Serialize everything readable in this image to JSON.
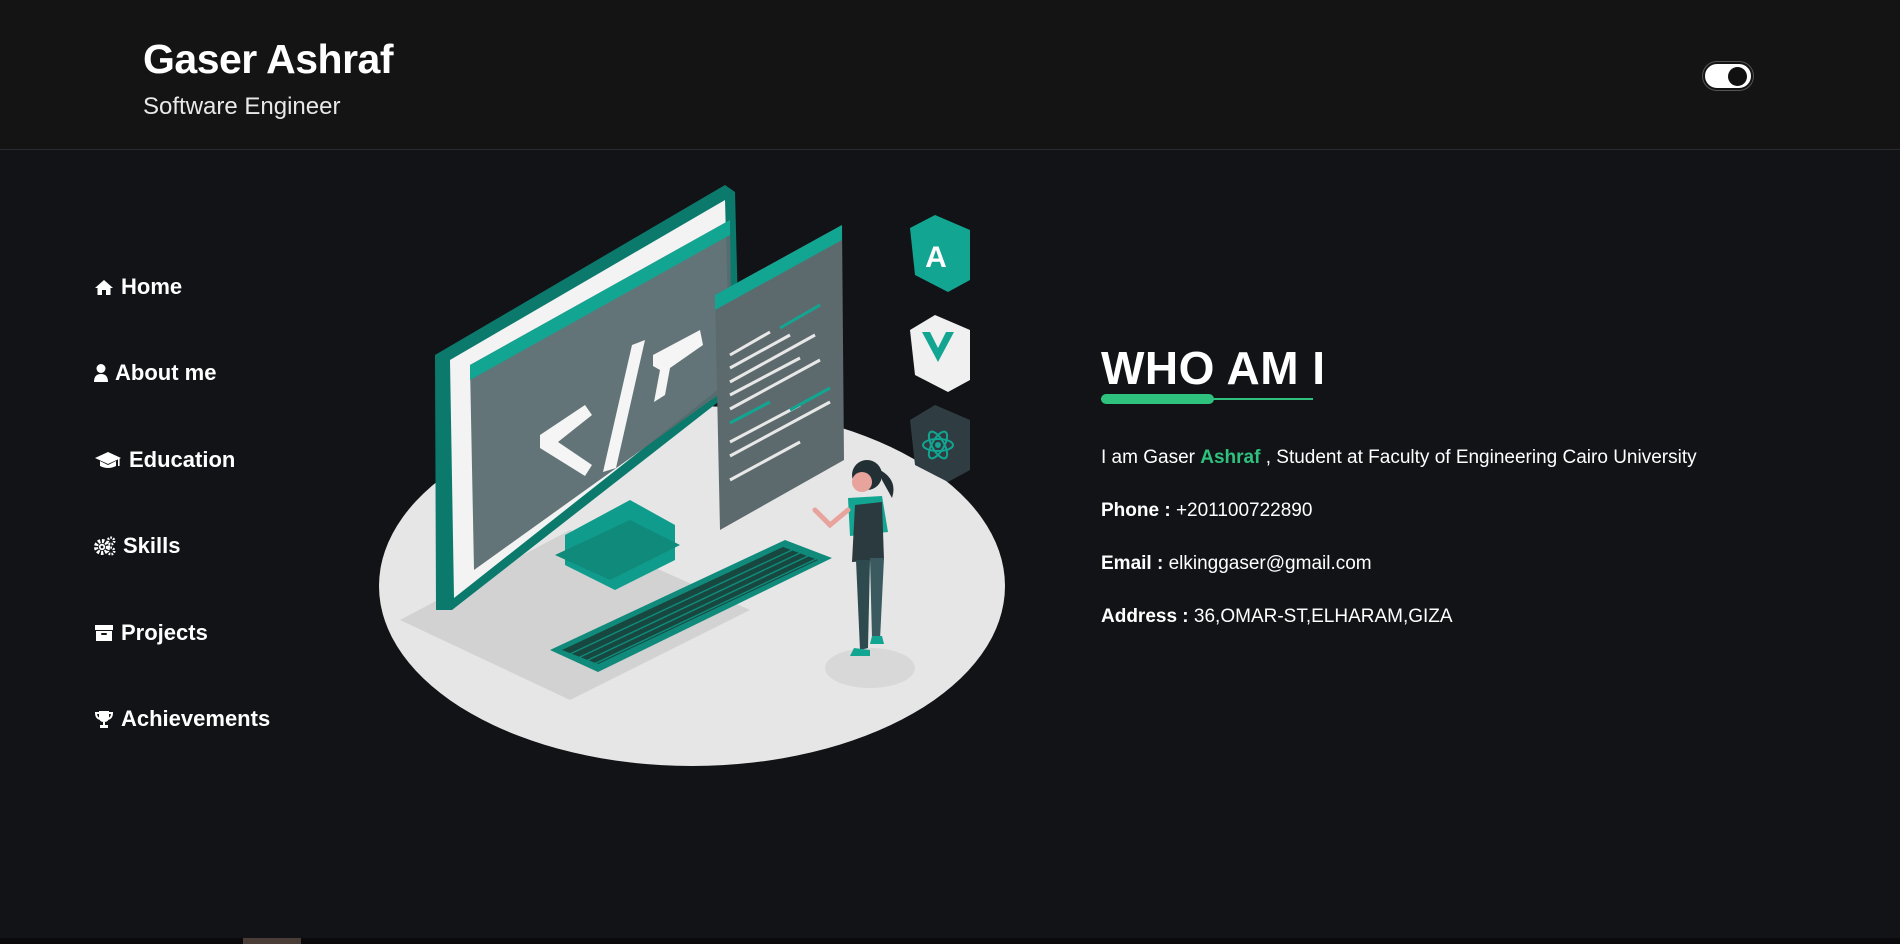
{
  "header": {
    "name": "Gaser Ashraf",
    "role": "Software Engineer",
    "theme_toggle": "dark-mode-toggle"
  },
  "nav": {
    "items": [
      {
        "label": "Home",
        "icon": "home-icon"
      },
      {
        "label": "About me",
        "icon": "user-icon"
      },
      {
        "label": "Education",
        "icon": "graduation-cap-icon"
      },
      {
        "label": "Skills",
        "icon": "gears-icon"
      },
      {
        "label": "Projects",
        "icon": "archive-box-icon"
      },
      {
        "label": "Achievements",
        "icon": "trophy-icon"
      }
    ]
  },
  "about": {
    "heading": "WHO AM I",
    "intro_prefix": "I am Gaser ",
    "intro_accent": "Ashraf",
    "intro_suffix": " , Student at Faculty of Engineering Cairo University",
    "phone_label": "Phone :",
    "phone_value": " +201100722890",
    "email_label": "Email :",
    "email_value": " elkinggaser@gmail.com",
    "address_label": "Address :",
    "address_value": " 36,OMAR-ST,ELHARAM,GIZA"
  },
  "illustration": {
    "code_symbol": "</>",
    "badges": [
      "A",
      "V",
      "react-icon"
    ]
  },
  "colors": {
    "background": "#121317",
    "header_bg": "#141414",
    "accent": "#2ec27e",
    "teal": "#12a592"
  }
}
